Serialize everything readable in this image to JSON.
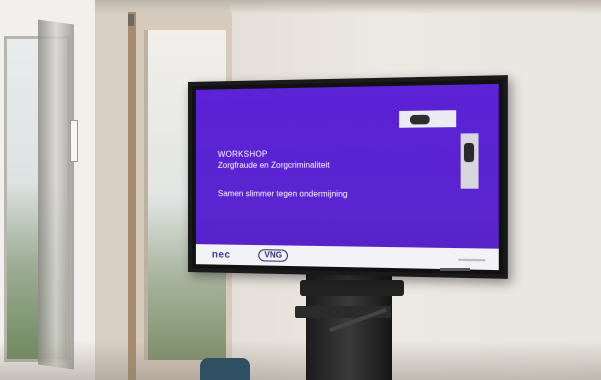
{
  "scene": {
    "description_kind": "photo of a wall-mounted TV on a stand in an office",
    "colors": {
      "screen_background": "#5b22d6",
      "bottom_bar": "#f3f2f6",
      "screen_text": "#ffffff"
    }
  },
  "slide": {
    "label": "WORKSHOP",
    "title": "Zorgfraude en Zorgcriminaliteit",
    "subtitle": "Samen slimmer tegen ondermijning",
    "logo_left": "nec",
    "logo_right": "VNG"
  }
}
